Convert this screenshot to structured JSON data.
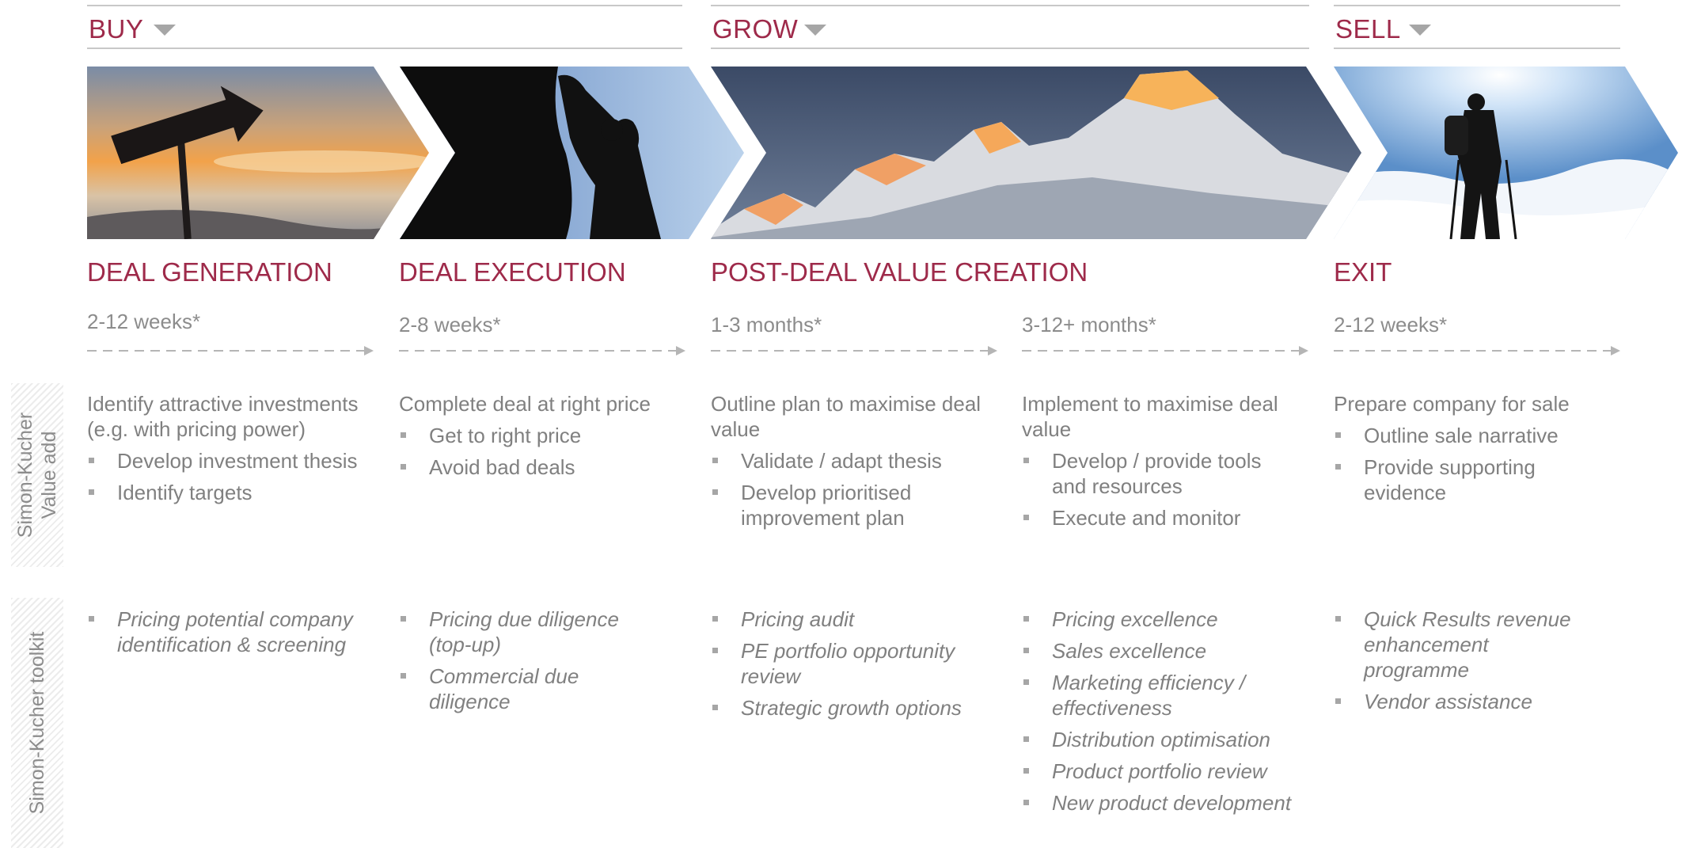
{
  "phases": [
    {
      "label": "BUY"
    },
    {
      "label": "GROW"
    },
    {
      "label": "SELL"
    }
  ],
  "stages": [
    {
      "title": "DEAL GENERATION"
    },
    {
      "title": "DEAL EXECUTION"
    },
    {
      "title": "POST-DEAL VALUE CREATION"
    },
    {
      "title": "EXIT"
    }
  ],
  "durations": [
    "2-12 weeks*",
    "2-8 weeks*",
    "1-3 months*",
    "3-12+ months*",
    "2-12 weeks*"
  ],
  "side_labels": {
    "value_add_line1": "Simon-Kucher",
    "value_add_line2": "Value add",
    "toolkit": "Simon-Kucher toolkit"
  },
  "value_add": [
    {
      "lead": "Identify attractive investments (e.g. with pricing power)",
      "items": [
        "Develop investment thesis",
        "Identify targets"
      ]
    },
    {
      "lead": "Complete deal at right price",
      "items": [
        "Get to right price",
        "Avoid bad deals"
      ]
    },
    {
      "lead": "Outline plan to maximise deal value",
      "items": [
        "Validate / adapt thesis",
        "Develop prioritised improvement plan"
      ]
    },
    {
      "lead": "Implement to maximise deal value",
      "items": [
        "Develop / provide tools and resources",
        "Execute and monitor"
      ]
    },
    {
      "lead": "Prepare company for sale",
      "items": [
        "Outline sale narrative",
        "Provide supporting evidence"
      ]
    }
  ],
  "toolkit": [
    {
      "items": [
        "Pricing potential company identification & screening"
      ]
    },
    {
      "items": [
        "Pricing due diligence (top-up)",
        "Commercial due diligence"
      ]
    },
    {
      "items": [
        "Pricing audit",
        "PE portfolio opportunity review",
        "Strategic growth options"
      ]
    },
    {
      "items": [
        "Pricing excellence",
        "Sales excellence",
        "Marketing efficiency / effectiveness",
        "Distribution optimisation",
        "Product portfolio review",
        "New product development"
      ]
    },
    {
      "items": [
        "Quick Results revenue enhancement programme",
        "Vendor assistance"
      ]
    }
  ],
  "colors": {
    "accent": "#9e2a4a",
    "text": "#808080",
    "rule": "#c8c8c8"
  },
  "images": [
    "signpost-sunset-photo",
    "climber-silhouette-photo",
    "mountain-peaks-photo",
    "hiker-above-clouds-photo"
  ]
}
